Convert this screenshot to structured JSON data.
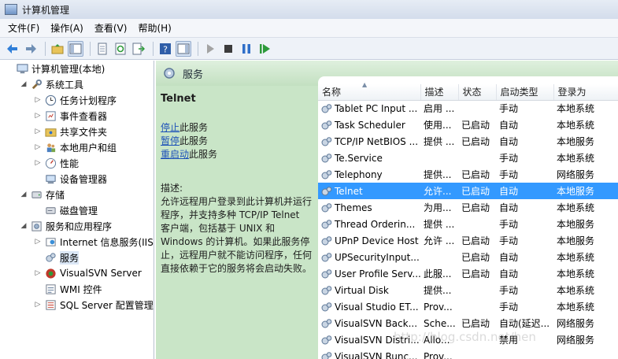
{
  "window": {
    "title": "计算机管理"
  },
  "menu": [
    "文件(F)",
    "操作(A)",
    "查看(V)",
    "帮助(H)"
  ],
  "tree": [
    {
      "label": "计算机管理(本地)",
      "indent": 0,
      "twisty": "",
      "icon": "computer-icon"
    },
    {
      "label": "系统工具",
      "indent": 1,
      "twisty": "◢",
      "icon": "tools-icon"
    },
    {
      "label": "任务计划程序",
      "indent": 2,
      "twisty": "▷",
      "icon": "clock-icon"
    },
    {
      "label": "事件查看器",
      "indent": 2,
      "twisty": "▷",
      "icon": "event-viewer-icon"
    },
    {
      "label": "共享文件夹",
      "indent": 2,
      "twisty": "▷",
      "icon": "shared-folder-icon"
    },
    {
      "label": "本地用户和组",
      "indent": 2,
      "twisty": "▷",
      "icon": "users-icon"
    },
    {
      "label": "性能",
      "indent": 2,
      "twisty": "▷",
      "icon": "performance-icon"
    },
    {
      "label": "设备管理器",
      "indent": 2,
      "twisty": "",
      "icon": "device-manager-icon"
    },
    {
      "label": "存储",
      "indent": 1,
      "twisty": "◢",
      "icon": "storage-icon"
    },
    {
      "label": "磁盘管理",
      "indent": 2,
      "twisty": "",
      "icon": "disk-icon"
    },
    {
      "label": "服务和应用程序",
      "indent": 1,
      "twisty": "◢",
      "icon": "services-apps-icon"
    },
    {
      "label": "Internet 信息服务(IIS)管理器",
      "indent": 2,
      "twisty": "▷",
      "icon": "iis-icon"
    },
    {
      "label": "服务",
      "indent": 2,
      "twisty": "",
      "icon": "services-icon",
      "selected": true
    },
    {
      "label": "VisualSVN Server",
      "indent": 2,
      "twisty": "▷",
      "icon": "svn-icon"
    },
    {
      "label": "WMI 控件",
      "indent": 2,
      "twisty": "",
      "icon": "wmi-icon"
    },
    {
      "label": "SQL Server 配置管理器",
      "indent": 2,
      "twisty": "▷",
      "icon": "sql-icon"
    }
  ],
  "services_header": "服务",
  "detail": {
    "name": "Telnet",
    "actions": [
      {
        "link": "停止",
        "rest": "此服务"
      },
      {
        "link": "暂停",
        "rest": "此服务"
      },
      {
        "link": "重启动",
        "rest": "此服务"
      }
    ],
    "description_label": "描述:",
    "description": "允许远程用户登录到此计算机并运行程序，并支持多种 TCP/IP Telnet 客户端，包括基于 UNIX 和 Windows 的计算机。如果此服务停止，远程用户就不能访问程序，任何直接依赖于它的服务将会启动失败。"
  },
  "table": {
    "columns": [
      "名称",
      "描述",
      "状态",
      "启动类型",
      "登录为"
    ],
    "rows": [
      [
        "Tablet PC Input ...",
        "启用 ...",
        "",
        "手动",
        "本地系统"
      ],
      [
        "Task Scheduler",
        "使用...",
        "已启动",
        "自动",
        "本地系统"
      ],
      [
        "TCP/IP NetBIOS ...",
        "提供 ...",
        "已启动",
        "自动",
        "本地服务"
      ],
      [
        "Te.Service",
        "",
        "",
        "手动",
        "本地系统"
      ],
      [
        "Telephony",
        "提供...",
        "已启动",
        "手动",
        "网络服务"
      ],
      [
        "Telnet",
        "允许...",
        "已启动",
        "自动",
        "本地服务"
      ],
      [
        "Themes",
        "为用...",
        "已启动",
        "自动",
        "本地系统"
      ],
      [
        "Thread Orderin...",
        "提供 ...",
        "",
        "手动",
        "本地服务"
      ],
      [
        "UPnP Device Host",
        "允许 ...",
        "已启动",
        "手动",
        "本地服务"
      ],
      [
        "UPSecurityInput...",
        "",
        "已启动",
        "自动",
        "本地系统"
      ],
      [
        "User Profile Serv...",
        "此服...",
        "已启动",
        "自动",
        "本地系统"
      ],
      [
        "Virtual Disk",
        "提供...",
        "",
        "手动",
        "本地系统"
      ],
      [
        "Visual Studio ET...",
        "Prov...",
        "",
        "手动",
        "本地系统"
      ],
      [
        "VisualSVN Back...",
        "Sche...",
        "已启动",
        "自动(延迟...",
        "网络服务"
      ],
      [
        "VisualSVN Distri...",
        "Allo...",
        "",
        "禁用",
        "网络服务"
      ],
      [
        "VisualSVN Runc...",
        "Prov...",
        "",
        "",
        ""
      ]
    ],
    "selected_index": 5
  },
  "watermark": "http://blog.csdn.net/hen"
}
